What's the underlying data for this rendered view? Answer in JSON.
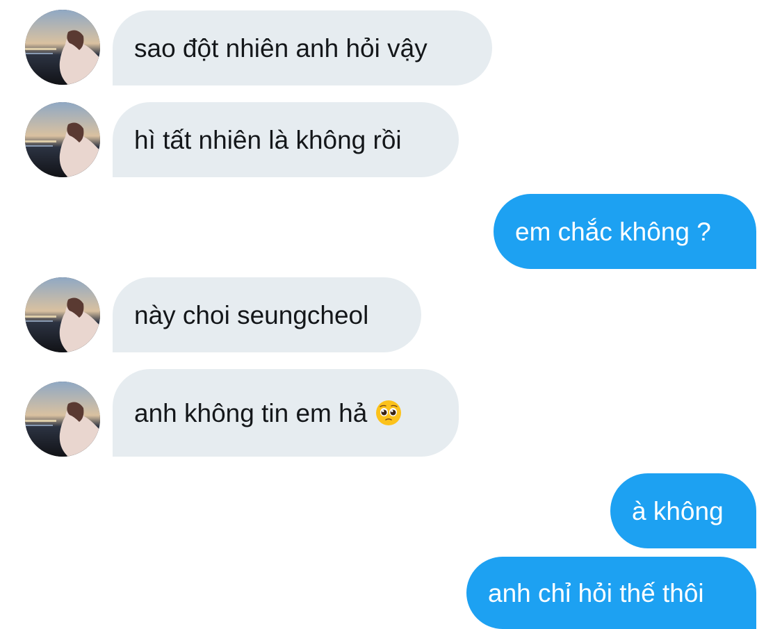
{
  "conversation": {
    "messages": [
      {
        "sender": "contact",
        "text": "sao đột nhiên anh hỏi vậy"
      },
      {
        "sender": "contact",
        "text": "hì tất nhiên là không rồi"
      },
      {
        "sender": "me",
        "text": "em chắc không ?"
      },
      {
        "sender": "contact",
        "text": "này choi seungcheol"
      },
      {
        "sender": "contact",
        "text": "anh không tin em hả",
        "emoji": "pleading-face-icon"
      },
      {
        "sender": "me",
        "text": "à không"
      },
      {
        "sender": "me",
        "text": "anh chỉ hỏi thế thôi"
      }
    ]
  },
  "colors": {
    "incoming_bubble": "#e6ecf0",
    "incoming_text": "#14171a",
    "outgoing_bubble": "#1da1f2",
    "outgoing_text": "#ffffff"
  }
}
